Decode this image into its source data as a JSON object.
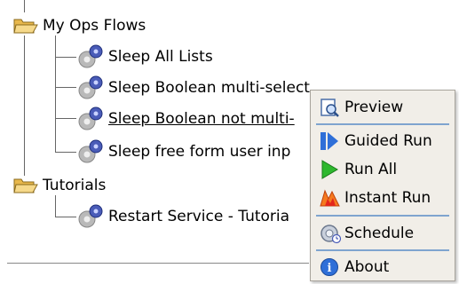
{
  "tree": {
    "folders": [
      {
        "label": "My Ops Flows",
        "items": [
          {
            "label": "Sleep All Lists"
          },
          {
            "label": "Sleep Boolean multi-select"
          },
          {
            "label": "Sleep Boolean not multi-"
          },
          {
            "label": "Sleep free form user inp"
          }
        ]
      },
      {
        "label": "Tutorials",
        "items": [
          {
            "label": "Restart Service - Tutoria"
          }
        ]
      }
    ]
  },
  "context_menu": {
    "items": [
      {
        "label": "Preview",
        "icon": "preview-icon"
      },
      {
        "label": "Guided Run",
        "icon": "guided-run-icon"
      },
      {
        "label": "Run All",
        "icon": "run-all-icon"
      },
      {
        "label": "Instant Run",
        "icon": "instant-run-icon"
      },
      {
        "label": "Schedule",
        "icon": "schedule-icon"
      },
      {
        "label": "About",
        "icon": "about-icon"
      }
    ]
  },
  "colors": {
    "folder": "#f0c870",
    "gear": "#4a5cb8",
    "menu_bg": "#f1eee8",
    "menu_separator": "#7fa4cf"
  }
}
